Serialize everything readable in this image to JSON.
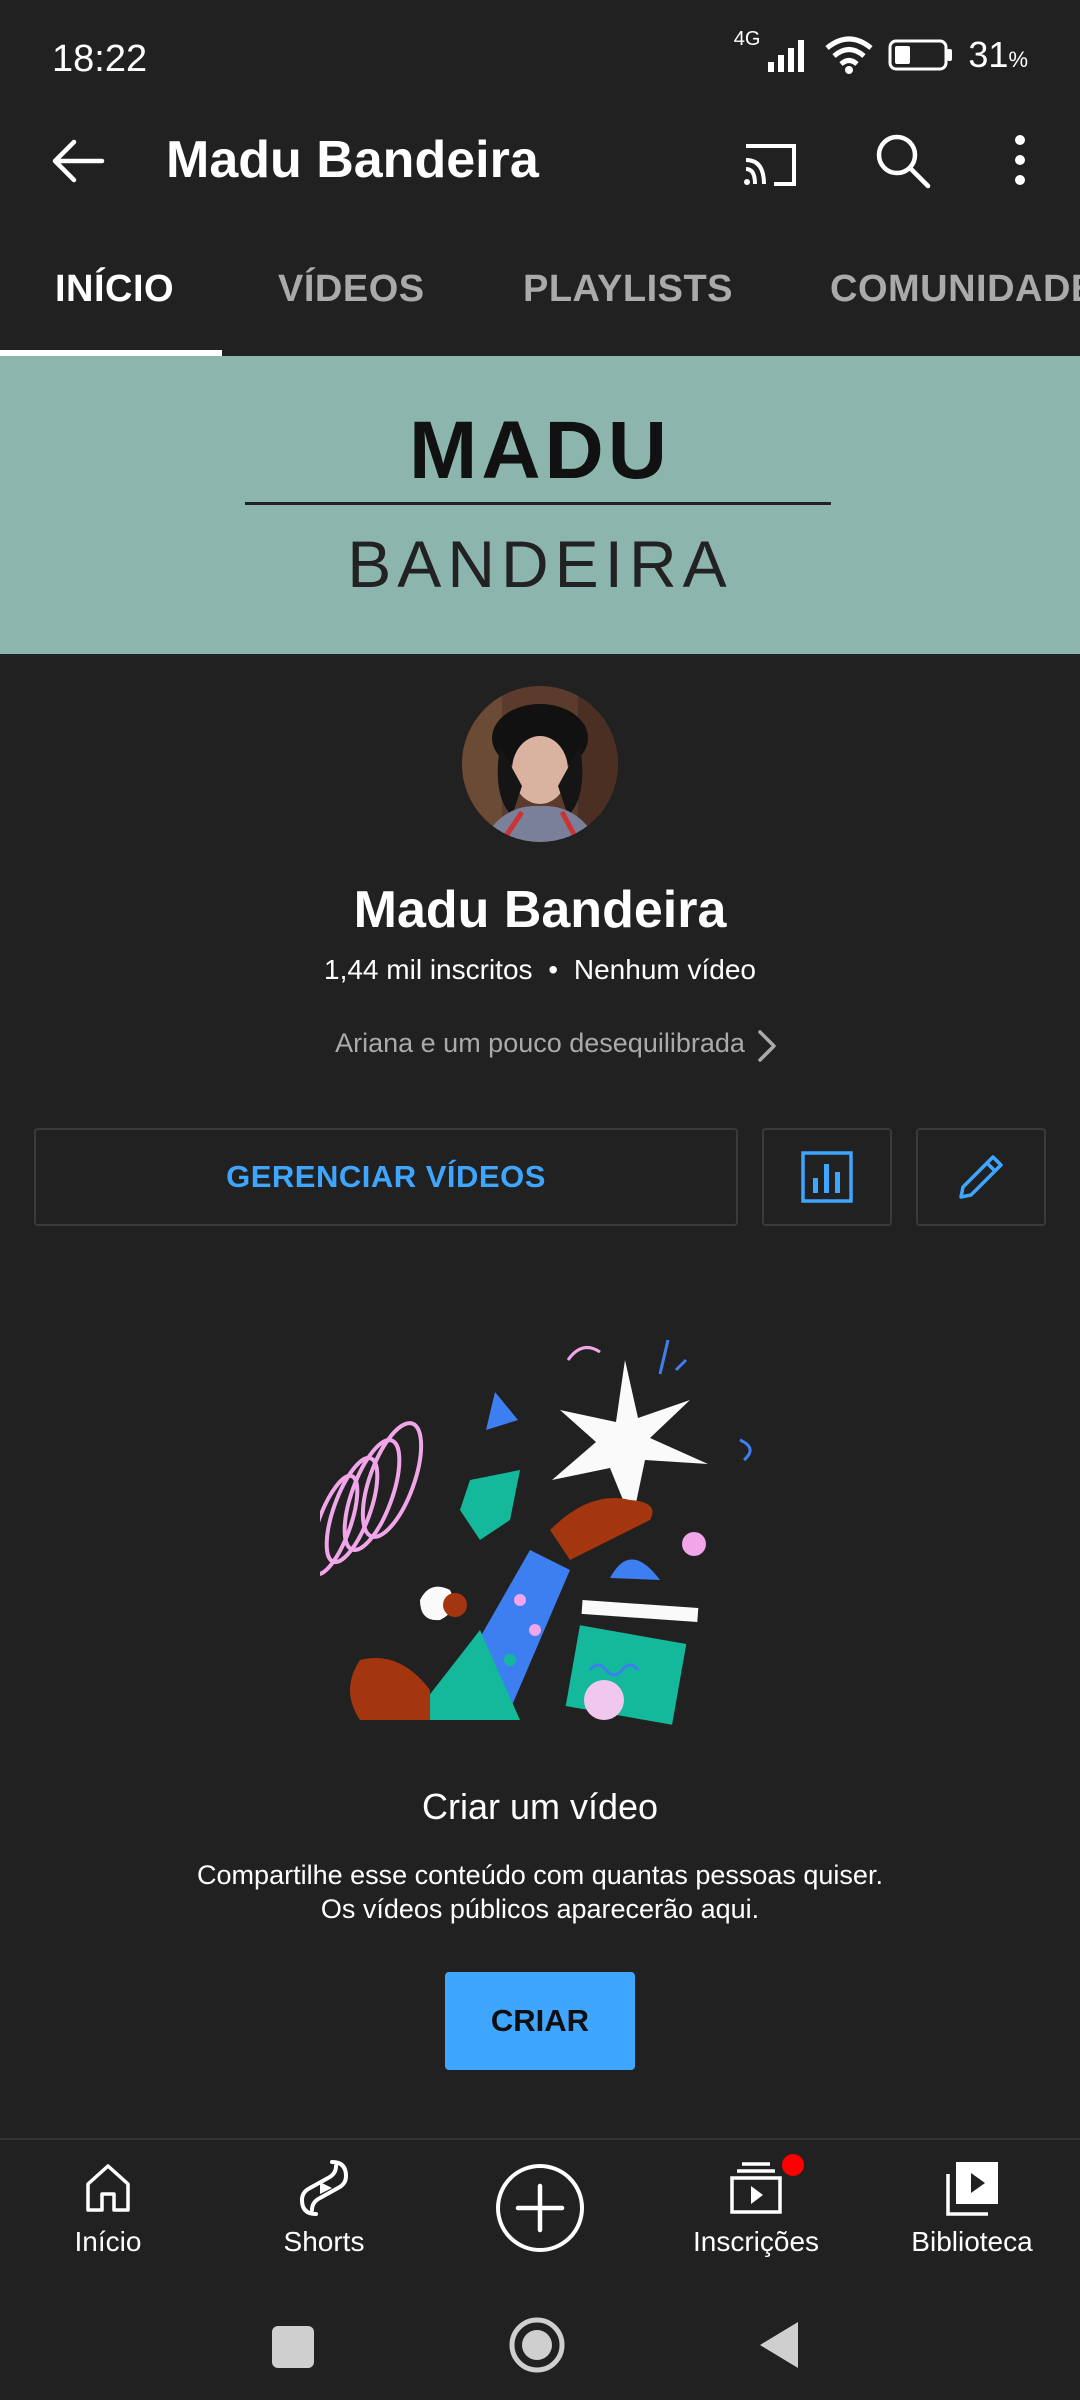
{
  "status_bar": {
    "time": "18:22",
    "network": "4G",
    "battery_percent": "31",
    "battery_unit": "%",
    "icons": [
      "signal-icon",
      "wifi-icon",
      "battery-icon"
    ]
  },
  "app_bar": {
    "title": "Madu Bandeira",
    "icons": [
      "back-arrow-icon",
      "cast-icon",
      "search-icon",
      "more-vert-icon"
    ]
  },
  "tabs": [
    {
      "label": "INÍCIO",
      "active": true
    },
    {
      "label": "VÍDEOS",
      "active": false
    },
    {
      "label": "PLAYLISTS",
      "active": false
    },
    {
      "label": "COMUNIDADE",
      "active": false
    }
  ],
  "banner": {
    "line1": "MADU",
    "line2": "BANDEIRA",
    "background": "#8cb5ae"
  },
  "channel": {
    "name": "Madu Bandeira",
    "subscribers": "1,44 mil inscritos",
    "separator": "•",
    "videos": "Nenhum vídeo",
    "description": "Ariana e um pouco desequilibrada"
  },
  "actions": {
    "manage_label": "GERENCIAR VÍDEOS",
    "analytics_icon": "analytics-icon",
    "edit_icon": "edit-pencil-icon"
  },
  "empty_state": {
    "title": "Criar um vídeo",
    "line1": "Compartilhe esse conteúdo com quantas pessoas quiser.",
    "line2": "Os vídeos públicos aparecerão aqui.",
    "button": "CRIAR"
  },
  "bottom_nav": [
    {
      "label": "Início",
      "icon": "home-icon"
    },
    {
      "label": "Shorts",
      "icon": "shorts-icon"
    },
    {
      "label": "",
      "icon": "create-plus-icon"
    },
    {
      "label": "Inscrições",
      "icon": "subscriptions-icon",
      "badge": true
    },
    {
      "label": "Biblioteca",
      "icon": "library-icon"
    }
  ],
  "colors": {
    "background": "#212121",
    "accent_blue": "#3ea6ff",
    "notification_red": "#ff0000"
  }
}
